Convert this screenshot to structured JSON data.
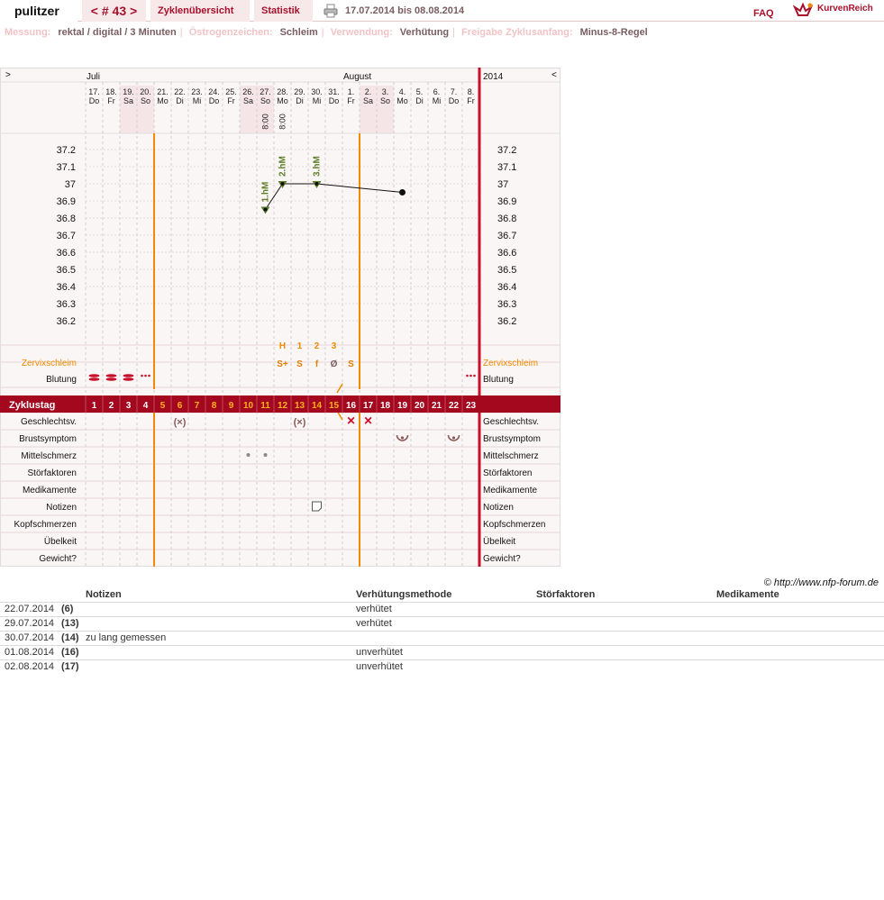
{
  "header": {
    "user": "pulitzer",
    "cycle_nav": "< # 43 >",
    "cycle_overview": "Zyklenübersicht",
    "statistics": "Statistik",
    "date_range": "17.07.2014 bis 08.08.2014",
    "faq": "FAQ",
    "logo": "KurvenReich"
  },
  "settings": [
    {
      "label": "Messung:",
      "value": "rektal / digital / 3 Minuten"
    },
    {
      "label": "Östrogenzeichen:",
      "value": "Schleim"
    },
    {
      "label": "Verwendung:",
      "value": "Verhütung"
    },
    {
      "label": "Freigabe Zyklusanfang:",
      "value": "Minus-8-Regel"
    }
  ],
  "chart": {
    "nav_prev": ">",
    "nav_next": "<",
    "year": "2014",
    "months": [
      {
        "name": "Juli",
        "day_index": 0
      },
      {
        "name": "August",
        "day_index": 15
      }
    ],
    "days": [
      {
        "date": "17.",
        "wd": "Do",
        "weekend": false,
        "cycle_day": "1"
      },
      {
        "date": "18.",
        "wd": "Fr",
        "weekend": false,
        "cycle_day": "2"
      },
      {
        "date": "19.",
        "wd": "Sa",
        "weekend": true,
        "cycle_day": "3"
      },
      {
        "date": "20.",
        "wd": "So",
        "weekend": true,
        "cycle_day": "4"
      },
      {
        "date": "21.",
        "wd": "Mo",
        "weekend": false,
        "cycle_day": "5"
      },
      {
        "date": "22.",
        "wd": "Di",
        "weekend": false,
        "cycle_day": "6"
      },
      {
        "date": "23.",
        "wd": "Mi",
        "weekend": false,
        "cycle_day": "7"
      },
      {
        "date": "24.",
        "wd": "Do",
        "weekend": false,
        "cycle_day": "8"
      },
      {
        "date": "25.",
        "wd": "Fr",
        "weekend": false,
        "cycle_day": "9"
      },
      {
        "date": "26.",
        "wd": "Sa",
        "weekend": true,
        "cycle_day": "10"
      },
      {
        "date": "27.",
        "wd": "So",
        "weekend": true,
        "cycle_day": "11",
        "time": "8:00"
      },
      {
        "date": "28.",
        "wd": "Mo",
        "weekend": false,
        "cycle_day": "12",
        "time": "8:00"
      },
      {
        "date": "29.",
        "wd": "Di",
        "weekend": false,
        "cycle_day": "13"
      },
      {
        "date": "30.",
        "wd": "Mi",
        "weekend": false,
        "cycle_day": "14"
      },
      {
        "date": "31.",
        "wd": "Do",
        "weekend": false,
        "cycle_day": "15"
      },
      {
        "date": "1.",
        "wd": "Fr",
        "weekend": false,
        "cycle_day": "16"
      },
      {
        "date": "2.",
        "wd": "Sa",
        "weekend": true,
        "cycle_day": "17"
      },
      {
        "date": "3.",
        "wd": "So",
        "weekend": true,
        "cycle_day": "18"
      },
      {
        "date": "4.",
        "wd": "Mo",
        "weekend": false,
        "cycle_day": "19"
      },
      {
        "date": "5.",
        "wd": "Di",
        "weekend": false,
        "cycle_day": "20"
      },
      {
        "date": "6.",
        "wd": "Mi",
        "weekend": false,
        "cycle_day": "21"
      },
      {
        "date": "7.",
        "wd": "Do",
        "weekend": false,
        "cycle_day": "22"
      },
      {
        "date": "8.",
        "wd": "Fr",
        "weekend": false,
        "cycle_day": "23"
      }
    ],
    "temp_ticks": [
      "37.2",
      "37.1",
      "37",
      "36.9",
      "36.8",
      "36.7",
      "36.6",
      "36.5",
      "36.4",
      "36.3",
      "36.2"
    ],
    "temp_range": [
      36.2,
      37.2
    ],
    "temperatures": [
      {
        "day_index": 10,
        "value": 36.85,
        "marker": "1.hM"
      },
      {
        "day_index": 11,
        "value": 37.0,
        "marker": "2.hM"
      },
      {
        "day_index": 13,
        "value": 37.0,
        "marker": "3.hM"
      },
      {
        "day_index": 18,
        "value": 36.95
      }
    ],
    "cycle_day_label": "Zyklustag",
    "orange_markers": [
      3,
      15
    ],
    "mucus_peak_labels": [
      {
        "day_index": 11,
        "text": "H"
      },
      {
        "day_index": 12,
        "text": "1"
      },
      {
        "day_index": 13,
        "text": "2"
      },
      {
        "day_index": 14,
        "text": "3"
      }
    ],
    "mucus_label": "Zervixschleim",
    "mucus": [
      {
        "day_index": 11,
        "text": "S+",
        "color": "#e38000"
      },
      {
        "day_index": 12,
        "text": "S",
        "color": "#e38000"
      },
      {
        "day_index": 13,
        "text": "f",
        "color": "#e38000"
      },
      {
        "day_index": 14,
        "text": "Ø",
        "color": "#7a5d60"
      },
      {
        "day_index": 15,
        "text": "S",
        "color": "#e38000"
      }
    ],
    "bleeding_label": "Blutung",
    "bleeding": [
      {
        "day_index": 0,
        "type": "heavy"
      },
      {
        "day_index": 1,
        "type": "heavy"
      },
      {
        "day_index": 2,
        "type": "heavy"
      },
      {
        "day_index": 3,
        "type": "spotting"
      },
      {
        "day_index": 22,
        "type": "spotting"
      }
    ],
    "rows": [
      {
        "label": "Geschlechtsv.",
        "marks": [
          {
            "day_index": 5,
            "text": "(×)"
          },
          {
            "day_index": 12,
            "text": "(×)"
          },
          {
            "day_index": 15,
            "text": "×"
          },
          {
            "day_index": 16,
            "text": "×"
          }
        ]
      },
      {
        "label": "Brustsymptom",
        "marks": [
          {
            "day_index": 18,
            "icon": "breast-icon"
          },
          {
            "day_index": 21,
            "icon": "breast-icon"
          }
        ]
      },
      {
        "label": "Mittelschmerz",
        "marks": [
          {
            "day_index": 9,
            "icon": "dot-icon"
          },
          {
            "day_index": 10,
            "icon": "dot-icon"
          }
        ]
      },
      {
        "label": "Störfaktoren",
        "marks": []
      },
      {
        "label": "Medikamente",
        "marks": []
      },
      {
        "label": "Notizen",
        "marks": [
          {
            "day_index": 13,
            "icon": "note-icon"
          }
        ]
      },
      {
        "label": "Kopfschmerzen",
        "marks": []
      },
      {
        "label": "Übelkeit",
        "marks": []
      },
      {
        "label": "Gewicht?",
        "marks": []
      }
    ],
    "colors": {
      "accent": "#a8102b",
      "orange": "#f08a00",
      "green": "#5d7f2a",
      "weekend": "#f5e5e7",
      "grid": "#cfcfcf",
      "bg": "#fbf6f6"
    }
  },
  "copyright": "© http://www.nfp-forum.de",
  "notes_table": {
    "headers": [
      "",
      "",
      "Notizen",
      "Verhütungsmethode",
      "Störfaktoren",
      "Medikamente"
    ],
    "rows": [
      [
        "22.07.2014",
        "(6)",
        "",
        "verhütet",
        "",
        ""
      ],
      [
        "29.07.2014",
        "(13)",
        "",
        "verhütet",
        "",
        ""
      ],
      [
        "30.07.2014",
        "(14)",
        "zu lang gemessen",
        "",
        "",
        ""
      ],
      [
        "01.08.2014",
        "(16)",
        "",
        "unverhütet",
        "",
        ""
      ],
      [
        "02.08.2014",
        "(17)",
        "",
        "unverhütet",
        "",
        ""
      ]
    ]
  }
}
